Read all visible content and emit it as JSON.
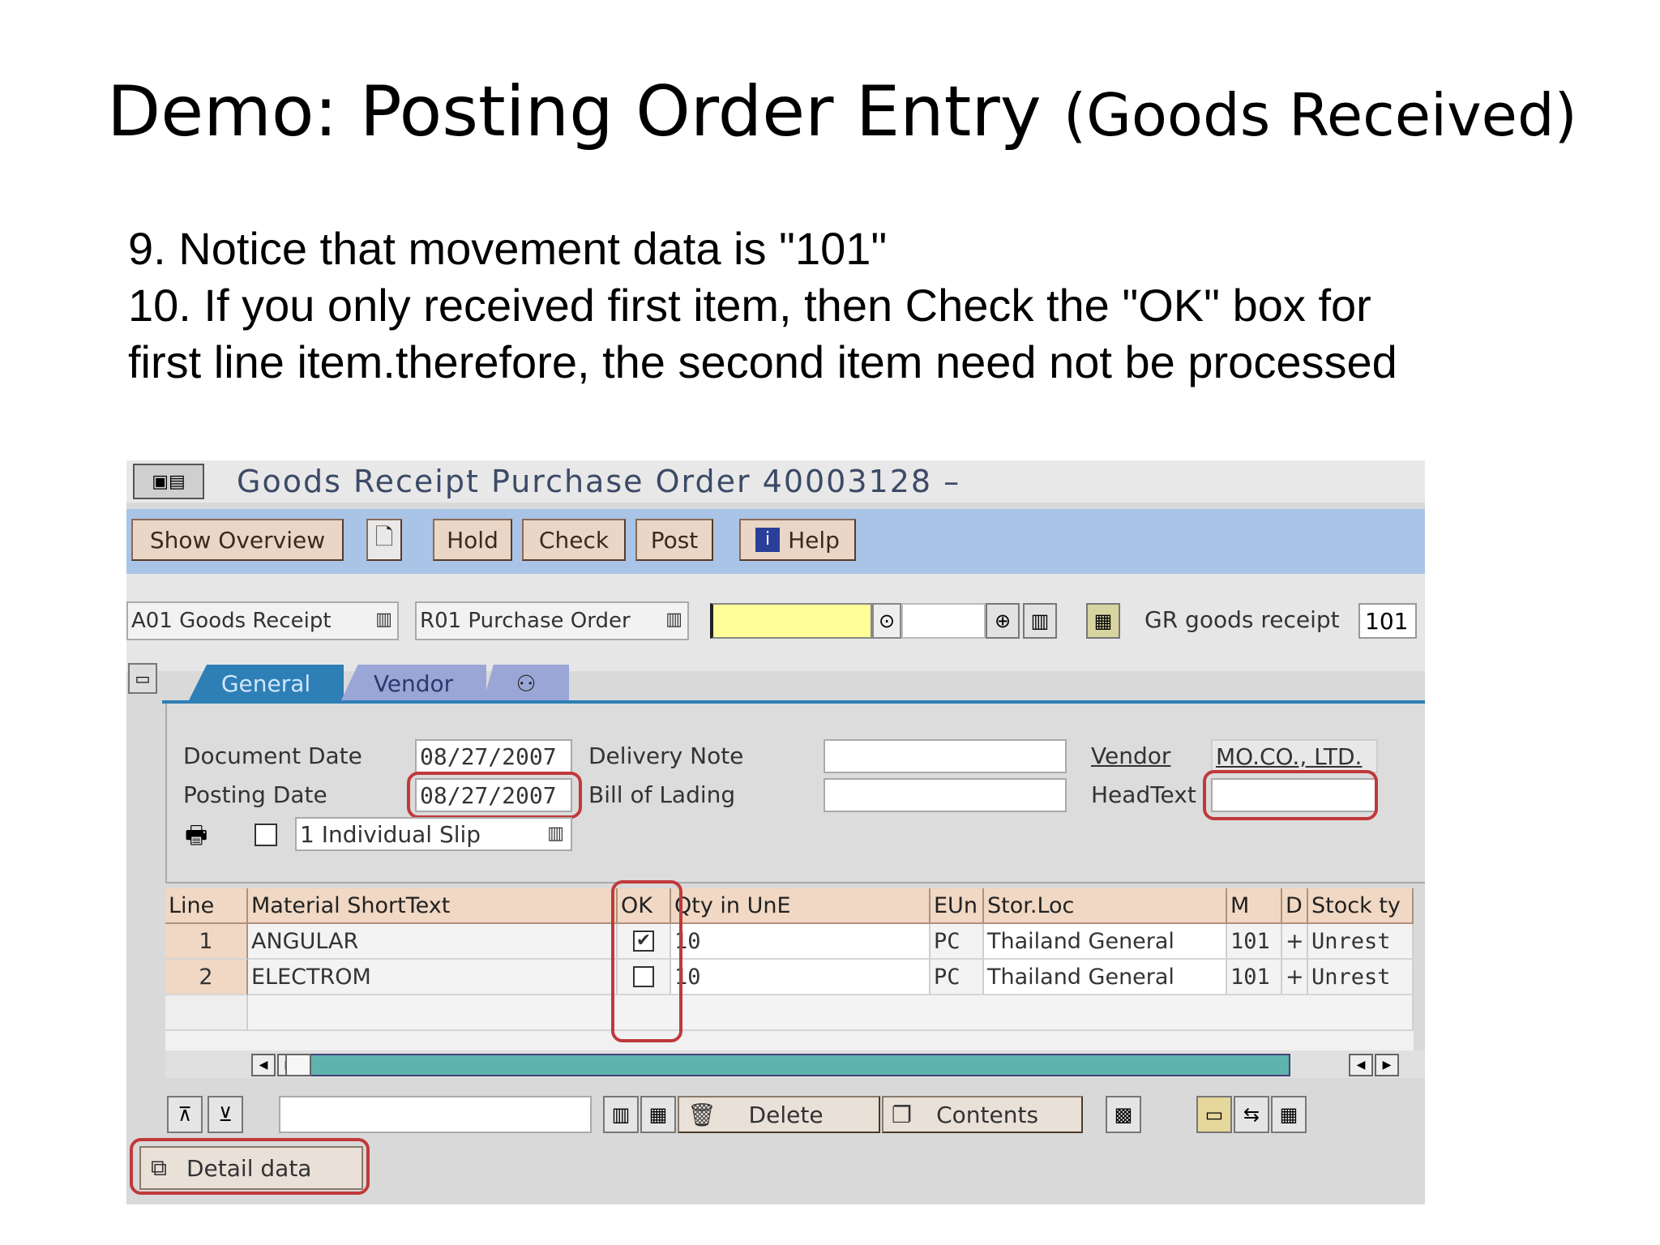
{
  "slide": {
    "title_main": "Demo: Posting Order Entry",
    "title_sub": "(Goods Received)",
    "instructions": [
      "9. Notice that movement data is \"101\"",
      "10. If you only received first item, then Check the \"OK\" box for",
      "first line item.therefore, the second item need not be processed"
    ]
  },
  "window": {
    "title": "Goods Receipt Purchase Order 40003128 –"
  },
  "toolbar": {
    "show_overview": "Show Overview",
    "hold": "Hold",
    "check": "Check",
    "post": "Post",
    "help": "Help"
  },
  "header": {
    "transaction": "A01 Goods Receipt",
    "reference": "R01 Purchase Order",
    "gr_label": "GR goods receipt",
    "movement_type": "101"
  },
  "tabs": [
    "General",
    "Vendor"
  ],
  "general": {
    "document_date_label": "Document Date",
    "document_date": "08/27/2007",
    "posting_date_label": "Posting Date",
    "posting_date": "08/27/2007",
    "delivery_note_label": "Delivery Note",
    "delivery_note": "",
    "bill_of_lading_label": "Bill of Lading",
    "bill_of_lading": "",
    "vendor_label": "Vendor",
    "vendor": "MO.CO., LTD.",
    "headtext_label": "HeadText",
    "headtext": "",
    "slip_type": "1 Individual Slip"
  },
  "items_table": {
    "headers": [
      "Line",
      "Material ShortText",
      "OK",
      "Qty in UnE",
      "EUn",
      "Stor.Loc",
      "M",
      "D",
      "Stock ty"
    ],
    "rows": [
      {
        "line": "1",
        "material": "ANGULAR",
        "ok": true,
        "qty": "10",
        "eun": "PC",
        "storloc": "Thailand General",
        "m": "101",
        "d": "+",
        "stock": "Unrest"
      },
      {
        "line": "2",
        "material": "ELECTROM",
        "ok": false,
        "qty": "10",
        "eun": "PC",
        "storloc": "Thailand General",
        "m": "101",
        "d": "+",
        "stock": "Unrest"
      }
    ]
  },
  "bottom": {
    "delete": "Delete",
    "contents": "Contents",
    "detail_data": "Detail data"
  },
  "colors": {
    "toolbar_bg": "#a9c4e6",
    "highlight_circle": "#c0393b",
    "general_tab": "#2e7fb5",
    "yellow_field": "#ffff99"
  }
}
